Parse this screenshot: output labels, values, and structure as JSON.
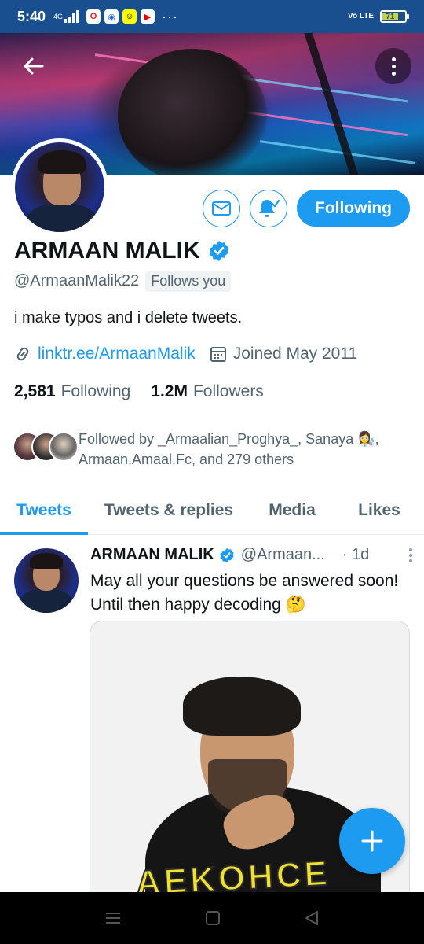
{
  "statusbar": {
    "time": "5:40",
    "network": "4G",
    "volte": "Vo LTE",
    "battery": "71"
  },
  "profile": {
    "name": "ARMAAN MALIK",
    "handle": "@ArmaanMalik22",
    "follows_you": "Follows you",
    "bio": "i make typos and i delete tweets.",
    "link": "linktr.ee/ArmaanMalik",
    "joined": "Joined May 2011",
    "following_count": "2,581",
    "following_label": "Following",
    "followers_count": "1.2M",
    "followers_label": "Followers",
    "followed_by_line1": "Followed by _Armaalian_Proghya_, Sanaya 👩‍🔬,",
    "followed_by_line2": "Armaan.Amaal.Fc, and 279 others",
    "follow_button": "Following"
  },
  "tabs": [
    {
      "label": "Tweets",
      "active": true
    },
    {
      "label": "Tweets & replies",
      "active": false
    },
    {
      "label": "Media",
      "active": false
    },
    {
      "label": "Likes",
      "active": false
    }
  ],
  "tweet": {
    "name": "ARMAAN MALIK",
    "handle": "@Armaan...",
    "time": "· 1d",
    "text": "May all your questions be answered soon! Until then happy decoding 🤔",
    "media_text": "AEKOHCE"
  },
  "colors": {
    "accent": "#1d9bf0",
    "statusbar": "#1a4f8f",
    "text": "#0f1419",
    "secondary": "#536471"
  }
}
